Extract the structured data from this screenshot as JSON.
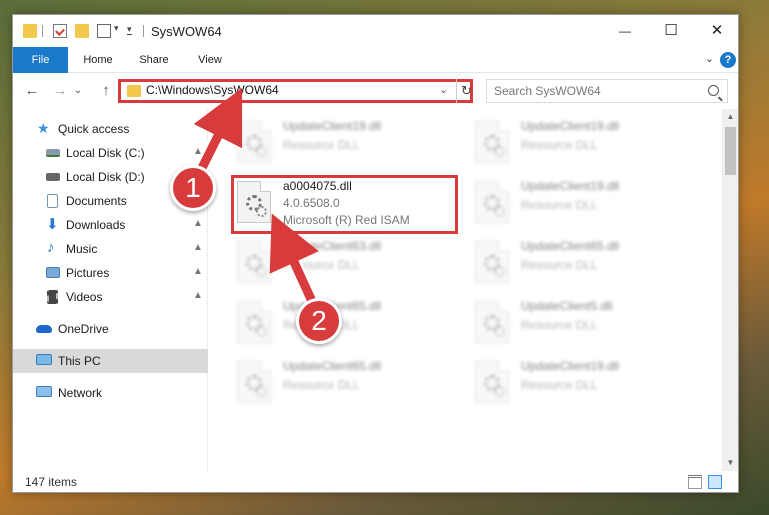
{
  "window": {
    "title": "SysWOW64",
    "controls": {
      "minimize": "—",
      "maximize": "☐",
      "close": "✕"
    }
  },
  "ribbon": {
    "tabs": [
      "File",
      "Home",
      "Share",
      "View"
    ],
    "help": "?"
  },
  "navigation": {
    "back": "←",
    "forward": "→",
    "recent": "⌄",
    "up": "↑",
    "address": "C:\\Windows\\SysWOW64",
    "dropdown": "⌄",
    "refresh": "↻",
    "search_placeholder": "Search SysWOW64"
  },
  "sidebar": {
    "items": [
      {
        "label": "Quick access",
        "icon": "star-icon",
        "color": "#3d8fe0",
        "pinned": false
      },
      {
        "label": "Local Disk (C:)",
        "icon": "drive-icon",
        "color": "#7a8a9a",
        "pinned": true
      },
      {
        "label": "Local Disk (D:)",
        "icon": "drive-icon",
        "color": "#5a5a5a",
        "pinned": false
      },
      {
        "label": "Documents",
        "icon": "documents-icon",
        "color": "#8aa4c8",
        "pinned": true
      },
      {
        "label": "Downloads",
        "icon": "downloads-icon",
        "color": "#2a7ad4",
        "pinned": true
      },
      {
        "label": "Music",
        "icon": "music-icon",
        "color": "#2a7ad4",
        "pinned": true
      },
      {
        "label": "Pictures",
        "icon": "pictures-icon",
        "color": "#4a8ac8",
        "pinned": true
      },
      {
        "label": "Videos",
        "icon": "videos-icon",
        "color": "#333333",
        "pinned": true
      },
      {
        "label": "OneDrive",
        "icon": "onedrive-icon",
        "color": "#1b6ac9",
        "pinned": false
      },
      {
        "label": "This PC",
        "icon": "this-pc-icon",
        "color": "#3a7ac0",
        "pinned": false,
        "selected": true
      },
      {
        "label": "Network",
        "icon": "network-icon",
        "color": "#3a7ac0",
        "pinned": false
      }
    ],
    "pin_glyph": "📌"
  },
  "files": [
    {
      "name": "UpdateClient19.dll",
      "type": "Resource DLL",
      "blurred": true
    },
    {
      "name": "UpdateClient19.dll",
      "type": "Resource DLL",
      "blurred": true
    },
    {
      "name": "a0004075.dll",
      "version": "4.0.6508.0",
      "type": "Microsoft (R) Red ISAM",
      "blurred": false,
      "highlighted": true
    },
    {
      "name": "UpdateClient19.dll",
      "type": "Resource DLL",
      "blurred": true
    },
    {
      "name": "UpdateClient63.dll",
      "type": "Resource DLL",
      "blurred": true
    },
    {
      "name": "UpdateClient65.dll",
      "type": "Resource DLL",
      "blurred": true
    },
    {
      "name": "UpdateClient65.dll",
      "type": "Resource DLL",
      "blurred": true
    },
    {
      "name": "UpdateClient5.dll",
      "type": "Resource DLL",
      "blurred": true
    },
    {
      "name": "UpdateClient65.dll",
      "type": "Resource DLL",
      "blurred": true
    },
    {
      "name": "UpdateClient19.dll",
      "type": "Resource DLL",
      "blurred": true
    }
  ],
  "status": {
    "item_count": "147 items"
  },
  "annotations": {
    "step1": "1",
    "step2": "2",
    "color": "#d83b3b"
  }
}
